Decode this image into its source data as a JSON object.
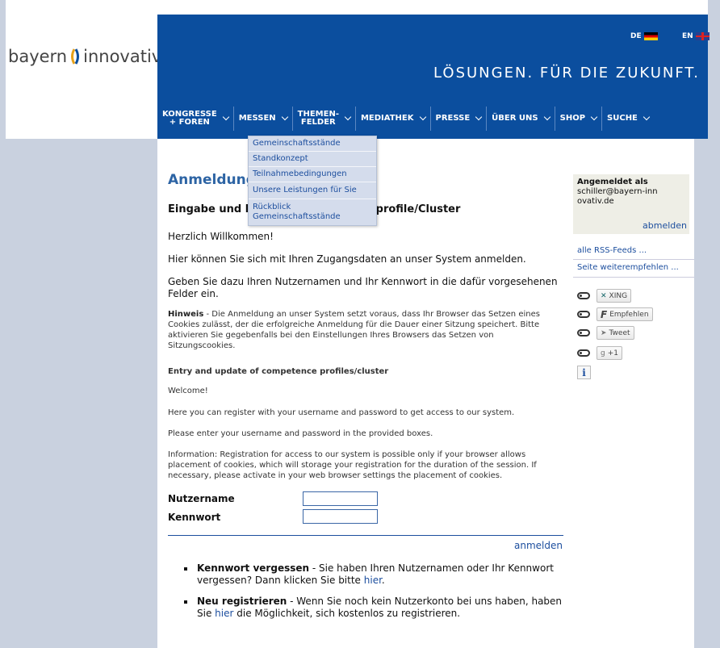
{
  "brand": {
    "part1": "bayern",
    "part2": "innovativ"
  },
  "header": {
    "tagline": "LÖSUNGEN. FÜR DIE ZUKUNFT.",
    "lang_de": "DE",
    "lang_en": "EN"
  },
  "nav": {
    "items": [
      {
        "line1": "KONGRESSE",
        "line2": "+ FOREN"
      },
      {
        "line1": "MESSEN",
        "line2": ""
      },
      {
        "line1": "THEMEN-",
        "line2": "FELDER"
      },
      {
        "line1": "MEDIATHEK",
        "line2": ""
      },
      {
        "line1": "PRESSE",
        "line2": ""
      },
      {
        "line1": "ÜBER UNS",
        "line2": ""
      },
      {
        "line1": "SHOP",
        "line2": ""
      },
      {
        "line1": "SUCHE",
        "line2": ""
      }
    ]
  },
  "dropdown": {
    "items": [
      "Gemeinschaftsstände",
      "Standkonzept",
      "Teilnahmebedingungen",
      "Unsere Leistungen für Sie",
      "Rückblick Gemeinschaftsstände"
    ]
  },
  "main": {
    "title": "Anmeldung",
    "subtitle": "Eingabe und Pflege der Kompetenzprofile/Cluster",
    "welcome_de": "Herzlich Willkommen!",
    "intro_de": "Hier können Sie sich mit Ihren Zugangsdaten an unser System anmelden.",
    "enter_de": "Geben Sie dazu Ihren Nutzernamen und Ihr Kennwort in die dafür vorgesehenen Felder ein.",
    "hint_label": "Hinweis",
    "hint_de": " - Die Anmeldung an unser System setzt voraus, dass Ihr Browser das Setzen eines Cookies zulässt, der die erfolgreiche Anmeldung für die Dauer einer Sitzung speichert. Bitte aktivieren Sie gegebenfalls bei den Einstellungen Ihres Browsers das Setzen von Sitzungscookies.",
    "en_title": "Entry and update of competence profiles/cluster",
    "en_welcome": "Welcome!",
    "en_intro": "Here you can register with your username and password to get access to our system.",
    "en_enter": "Please enter your username and password in the provided boxes.",
    "en_info": "Information: Registration for access to our system is possible only if your browser allows placement of cookies, which will storage your registration for the duration of the session. If necessary, please activate in your web browser settings the placement of cookies."
  },
  "form": {
    "username_label": "Nutzername",
    "username_value": "",
    "password_label": "Kennwort",
    "password_value": "",
    "submit_label": "anmelden"
  },
  "bullets": {
    "forgot_title": "Kennwort vergessen",
    "forgot_text": " - Sie haben Ihren Nutzernamen oder Ihr Kennwort vergessen? Dann klicken Sie bitte ",
    "forgot_link": "hier",
    "forgot_end": ".",
    "register_title": "Neu registrieren",
    "register_text": " - Wenn Sie noch kein Nutzerkonto bei uns haben, haben Sie ",
    "register_link": "hier",
    "register_end": " die Möglichkeit, sich kostenlos zu registrieren."
  },
  "sidebar": {
    "logged_in_label": "Angemeldet als",
    "logged_in_user": "schiller@bayern-innovativ.de",
    "logout_label": "abmelden",
    "rss_label": "alle RSS-Feeds ...",
    "recommend_label": "Seite weiterempfehlen ...",
    "social": {
      "xing": "XING",
      "facebook": "Empfehlen",
      "twitter": "Tweet",
      "google": "+1"
    },
    "info_label": "i"
  }
}
